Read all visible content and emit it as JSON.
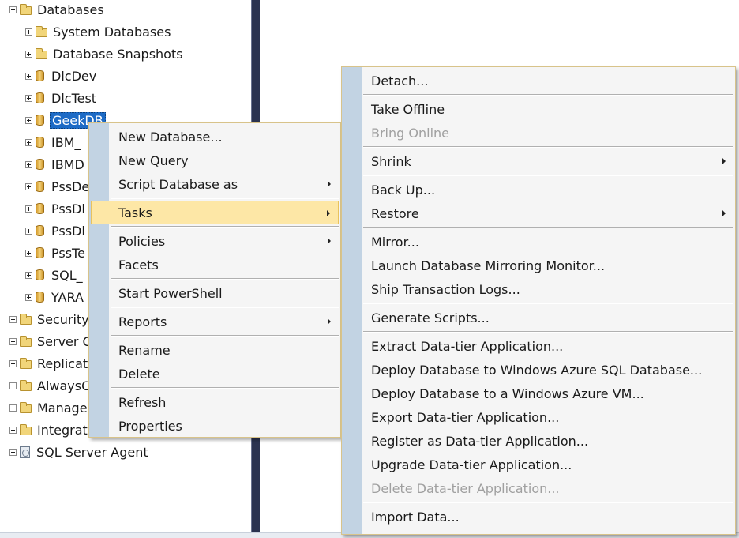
{
  "tree": {
    "nodes": [
      {
        "label": "Databases",
        "icon": "folder-icon",
        "expander": "minus",
        "name": "tree-node-databases"
      },
      {
        "label": "System Databases",
        "icon": "folder-icon",
        "expander": "plus",
        "name": "tree-node-system-databases"
      },
      {
        "label": "Database Snapshots",
        "icon": "folder-icon",
        "expander": "plus",
        "name": "tree-node-database-snapshots"
      },
      {
        "label": "DlcDev",
        "icon": "database-icon",
        "expander": "plus",
        "name": "tree-node-dlcdev"
      },
      {
        "label": "DlcTest",
        "icon": "database-icon",
        "expander": "plus",
        "name": "tree-node-dlctest"
      },
      {
        "label": "GeekDB",
        "icon": "database-icon",
        "expander": "plus",
        "name": "tree-node-geekdb",
        "selected": true
      },
      {
        "label": "IBM_",
        "icon": "database-icon",
        "expander": "plus",
        "name": "tree-node-ibm"
      },
      {
        "label": "IBMD",
        "icon": "database-icon",
        "expander": "plus",
        "name": "tree-node-ibmd"
      },
      {
        "label": "PssDe",
        "icon": "database-icon",
        "expander": "plus",
        "name": "tree-node-pssde"
      },
      {
        "label": "PssDl",
        "icon": "database-icon",
        "expander": "plus",
        "name": "tree-node-pssdl-1"
      },
      {
        "label": "PssDl",
        "icon": "database-icon",
        "expander": "plus",
        "name": "tree-node-pssdl-2"
      },
      {
        "label": "PssTe",
        "icon": "database-icon",
        "expander": "plus",
        "name": "tree-node-psste"
      },
      {
        "label": "SQL_",
        "icon": "database-icon",
        "expander": "plus",
        "name": "tree-node-sql"
      },
      {
        "label": "YARA",
        "icon": "database-icon",
        "expander": "plus",
        "name": "tree-node-yara"
      },
      {
        "label": "Security",
        "icon": "folder-icon",
        "expander": "plus",
        "name": "tree-node-security"
      },
      {
        "label": "Server O",
        "icon": "folder-icon",
        "expander": "plus",
        "name": "tree-node-server-objects"
      },
      {
        "label": "Replicati",
        "icon": "folder-icon",
        "expander": "plus",
        "name": "tree-node-replication"
      },
      {
        "label": "AlwaysO",
        "icon": "folder-icon",
        "expander": "plus",
        "name": "tree-node-alwayson"
      },
      {
        "label": "Manage",
        "icon": "folder-icon",
        "expander": "plus",
        "name": "tree-node-management"
      },
      {
        "label": "Integrat",
        "icon": "folder-icon",
        "expander": "plus",
        "name": "tree-node-integration"
      },
      {
        "label": "SQL Server Agent",
        "icon": "agent-icon",
        "expander": "plus",
        "name": "tree-node-sql-server-agent"
      }
    ]
  },
  "context_menu": {
    "items": [
      {
        "label": "New Database...",
        "name": "menu-item-new-database"
      },
      {
        "label": "New Query",
        "name": "menu-item-new-query"
      },
      {
        "label": "Script Database as",
        "name": "menu-item-script-database-as",
        "submenu": true
      },
      {
        "separator": true
      },
      {
        "label": "Tasks",
        "name": "menu-item-tasks",
        "submenu": true,
        "highlighted": true
      },
      {
        "separator": true
      },
      {
        "label": "Policies",
        "name": "menu-item-policies",
        "submenu": true
      },
      {
        "label": "Facets",
        "name": "menu-item-facets"
      },
      {
        "separator": true
      },
      {
        "label": "Start PowerShell",
        "name": "menu-item-start-powershell"
      },
      {
        "separator": true
      },
      {
        "label": "Reports",
        "name": "menu-item-reports",
        "submenu": true
      },
      {
        "separator": true
      },
      {
        "label": "Rename",
        "name": "menu-item-rename"
      },
      {
        "label": "Delete",
        "name": "menu-item-delete"
      },
      {
        "separator": true
      },
      {
        "label": "Refresh",
        "name": "menu-item-refresh"
      },
      {
        "label": "Properties",
        "name": "menu-item-properties"
      }
    ]
  },
  "tasks_submenu": {
    "items": [
      {
        "label": "Detach...",
        "name": "submenu-item-detach"
      },
      {
        "separator": true
      },
      {
        "label": "Take Offline",
        "name": "submenu-item-take-offline"
      },
      {
        "label": "Bring Online",
        "name": "submenu-item-bring-online",
        "disabled": true
      },
      {
        "separator": true
      },
      {
        "label": "Shrink",
        "name": "submenu-item-shrink",
        "submenu": true
      },
      {
        "separator": true
      },
      {
        "label": "Back Up...",
        "name": "submenu-item-back-up"
      },
      {
        "label": "Restore",
        "name": "submenu-item-restore",
        "submenu": true
      },
      {
        "separator": true
      },
      {
        "label": "Mirror...",
        "name": "submenu-item-mirror"
      },
      {
        "label": "Launch Database Mirroring Monitor...",
        "name": "submenu-item-launch-mirroring-monitor"
      },
      {
        "label": "Ship Transaction Logs...",
        "name": "submenu-item-ship-transaction-logs"
      },
      {
        "separator": true
      },
      {
        "label": "Generate Scripts...",
        "name": "submenu-item-generate-scripts"
      },
      {
        "separator": true
      },
      {
        "label": "Extract Data-tier Application...",
        "name": "submenu-item-extract-data-tier"
      },
      {
        "label": "Deploy Database to Windows Azure SQL Database...",
        "name": "submenu-item-deploy-azure-sql"
      },
      {
        "label": "Deploy Database to a Windows Azure VM...",
        "name": "submenu-item-deploy-azure-vm"
      },
      {
        "label": "Export Data-tier Application...",
        "name": "submenu-item-export-data-tier"
      },
      {
        "label": "Register as Data-tier Application...",
        "name": "submenu-item-register-data-tier"
      },
      {
        "label": "Upgrade Data-tier Application...",
        "name": "submenu-item-upgrade-data-tier"
      },
      {
        "label": "Delete Data-tier Application...",
        "name": "submenu-item-delete-data-tier",
        "disabled": true
      },
      {
        "separator": true
      },
      {
        "label": "Import Data...",
        "name": "submenu-item-import-data"
      }
    ]
  },
  "colors": {
    "menu_gutter": "#c2d3e3",
    "highlight_bg": "#fde7a6",
    "selection_bg": "#1d6bc6",
    "splitter": "#2b3350",
    "disabled_text": "#a0a0a0"
  }
}
